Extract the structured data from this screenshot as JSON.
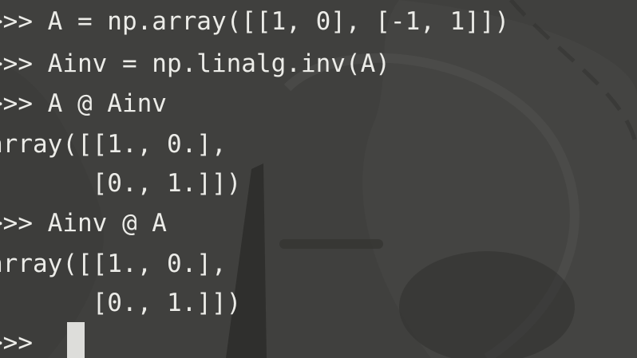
{
  "terminal": {
    "lines": [
      ">>> A = np.array([[1, 0], [-1, 1]])",
      ">>> Ainv = np.linalg.inv(A)",
      ">>> A @ Ainv",
      "array([[1., 0.],",
      "       [0., 1.]])",
      ">>> Ainv @ A",
      "array([[1., 0.],",
      "       [0., 1.]])",
      ">>> "
    ]
  }
}
